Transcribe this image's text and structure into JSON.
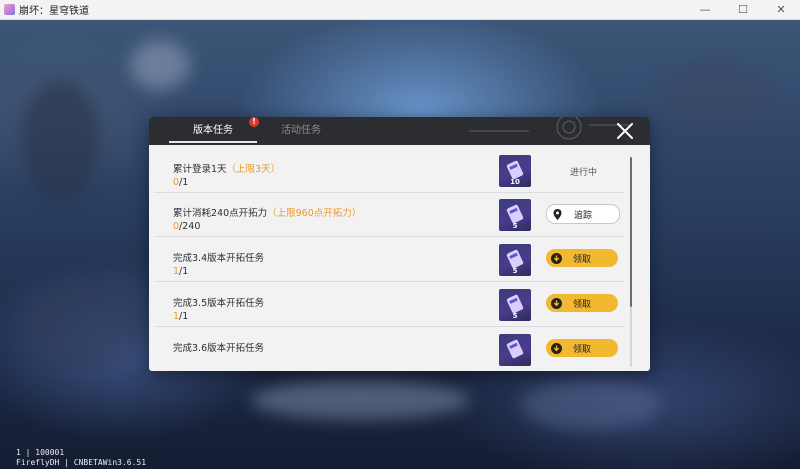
{
  "window": {
    "title": "崩坏：星穹铁道",
    "controls": [
      "—",
      "☐",
      "✕"
    ]
  },
  "footer": {
    "line1": "1 | 100001",
    "line2": "FireflyDH | CNBETAWin3.6.51"
  },
  "dialog": {
    "tabs": [
      {
        "label": "版本任务",
        "active": true,
        "badge": "!"
      },
      {
        "label": "活动任务",
        "active": false
      }
    ],
    "tasks": [
      {
        "title": "累计登录1天",
        "limit": "（上限3天）",
        "current": "0",
        "total": "/1",
        "reward_count": "10",
        "action": "status",
        "action_label": "进行中"
      },
      {
        "title": "累计消耗240点开拓力",
        "limit": "（上限960点开拓力）",
        "current": "0",
        "total": "/240",
        "reward_count": "5",
        "action": "track",
        "action_label": "追踪"
      },
      {
        "title": "完成3.4版本开拓任务",
        "limit": "",
        "current": "1",
        "total": "/1",
        "reward_count": "5",
        "action": "claim",
        "action_label": "领取"
      },
      {
        "title": "完成3.5版本开拓任务",
        "limit": "",
        "current": "1",
        "total": "/1",
        "reward_count": "5",
        "action": "claim",
        "action_label": "领取"
      },
      {
        "title": "完成3.6版本开拓任务",
        "limit": "",
        "current": "",
        "total": "",
        "reward_count": "",
        "action": "claim",
        "action_label": "领取"
      }
    ]
  },
  "colors": {
    "accent_orange": "#e89b28",
    "claim_button": "#f2b830",
    "header_dark": "#2b2d31",
    "badge_red": "#d63a2e"
  }
}
